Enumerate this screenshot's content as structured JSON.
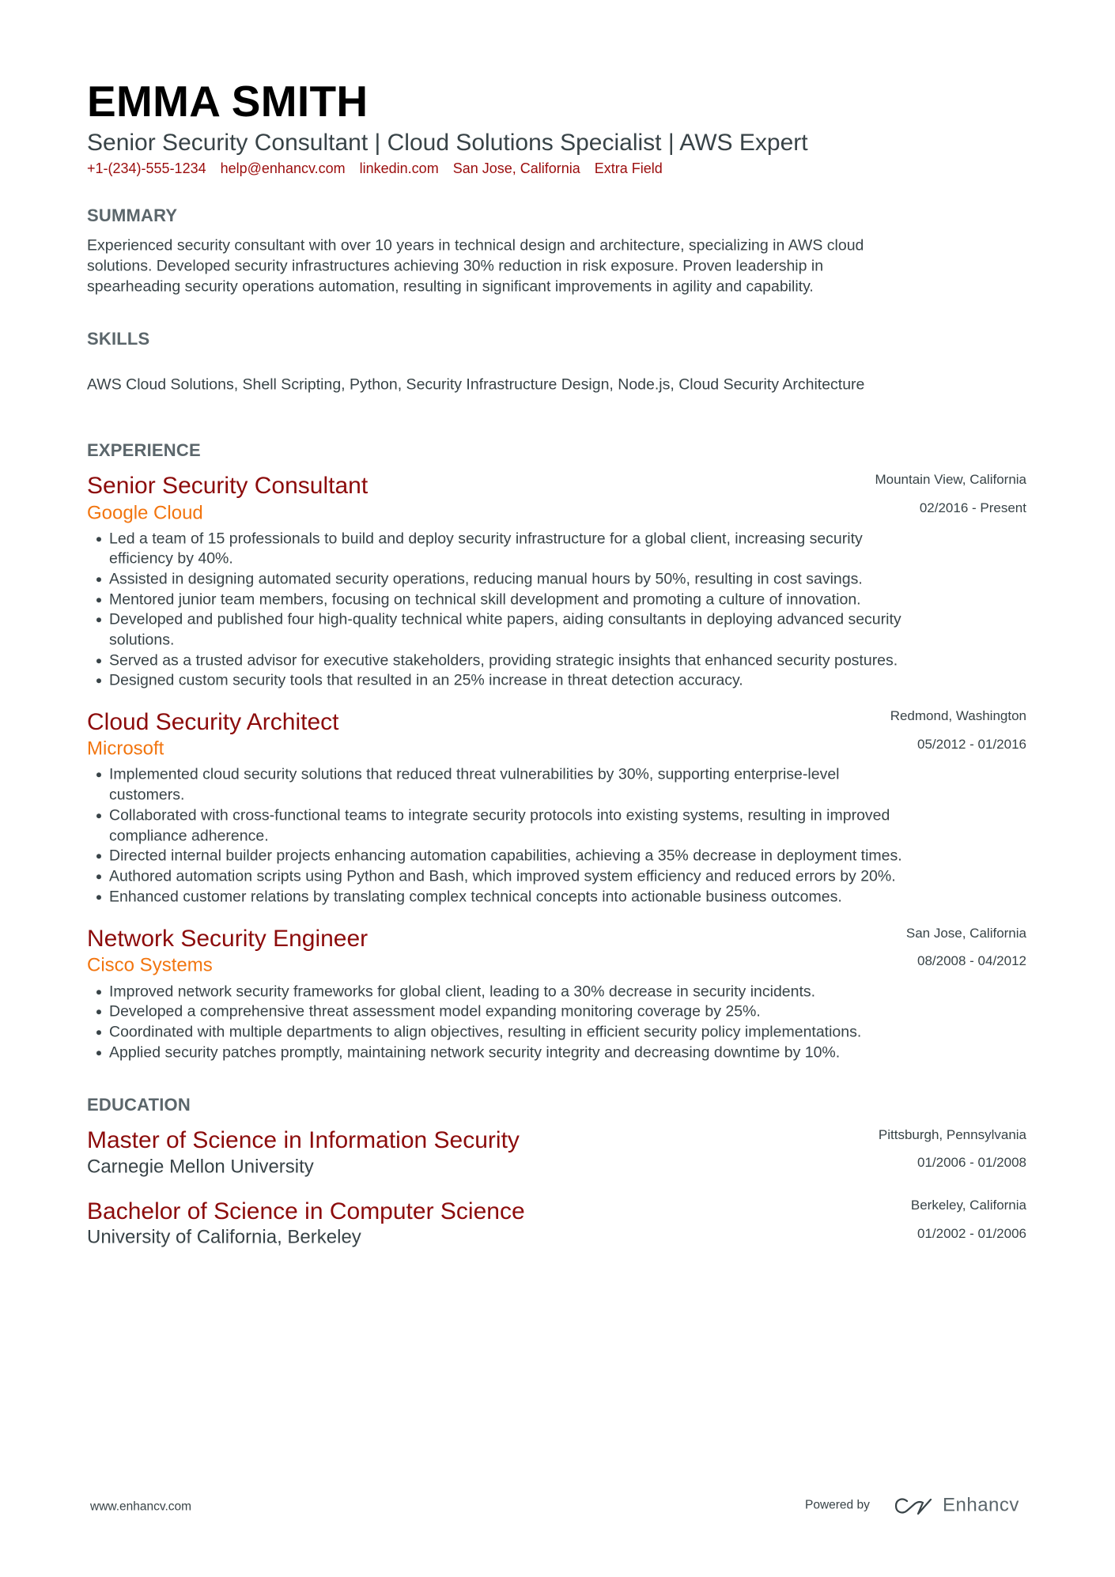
{
  "header": {
    "name": "EMMA SMITH",
    "headline": "Senior Security Consultant | Cloud Solutions Specialist | AWS Expert",
    "contacts": [
      "+1-(234)-555-1234",
      "help@enhancv.com",
      "linkedin.com",
      "San Jose, California",
      "Extra Field"
    ]
  },
  "summary": {
    "title": "SUMMARY",
    "lines": [
      "Experienced security consultant with over 10 years in technical design and architecture, specializing in AWS cloud",
      "solutions. Developed security infrastructures achieving 30% reduction in risk exposure. Proven leadership in",
      "spearheading security operations automation, resulting in significant improvements in agility and capability."
    ]
  },
  "skills": {
    "title": "SKILLS",
    "text": "AWS Cloud Solutions, Shell Scripting, Python, Security Infrastructure Design, Node.js, Cloud Security Architecture"
  },
  "experience": {
    "title": "EXPERIENCE",
    "jobs": [
      {
        "title": "Senior Security Consultant",
        "company": "Google Cloud",
        "location": "Mountain View, California",
        "dates": "02/2016 - Present",
        "bullets": [
          [
            "Led a team of 15 professionals to build and deploy security infrastructure for a global client, increasing security",
            "efficiency by 40%."
          ],
          [
            "Assisted in designing automated security operations, reducing manual hours by 50%, resulting in cost savings."
          ],
          [
            "Mentored junior team members, focusing on technical skill development and promoting a culture of innovation."
          ],
          [
            "Developed and published four high-quality technical white papers, aiding consultants in deploying advanced security",
            "solutions."
          ],
          [
            "Served as a trusted advisor for executive stakeholders, providing strategic insights that enhanced security postures."
          ],
          [
            "Designed custom security tools that resulted in an 25% increase in threat detection accuracy."
          ]
        ]
      },
      {
        "title": "Cloud Security Architect",
        "company": "Microsoft",
        "location": "Redmond, Washington",
        "dates": "05/2012 - 01/2016",
        "bullets": [
          [
            "Implemented cloud security solutions that reduced threat vulnerabilities by 30%, supporting enterprise-level",
            "customers."
          ],
          [
            "Collaborated with cross-functional teams to integrate security protocols into existing systems, resulting in improved",
            "compliance adherence."
          ],
          [
            "Directed internal builder projects enhancing automation capabilities, achieving a 35% decrease in deployment times."
          ],
          [
            "Authored automation scripts using Python and Bash, which improved system efficiency and reduced errors by 20%."
          ],
          [
            "Enhanced customer relations by translating complex technical concepts into actionable business outcomes."
          ]
        ]
      },
      {
        "title": "Network Security Engineer",
        "company": "Cisco Systems",
        "location": "San Jose, California",
        "dates": "08/2008 - 04/2012",
        "bullets": [
          [
            "Improved network security frameworks for global client, leading to a 30% decrease in security incidents."
          ],
          [
            "Developed a comprehensive threat assessment model expanding monitoring coverage by 25%."
          ],
          [
            "Coordinated with multiple departments to align objectives, resulting in efficient security policy implementations."
          ],
          [
            "Applied security patches promptly, maintaining network security integrity and decreasing downtime by 10%."
          ]
        ]
      }
    ]
  },
  "education": {
    "title": "EDUCATION",
    "items": [
      {
        "degree": "Master of Science in Information Security",
        "school": "Carnegie Mellon University",
        "location": "Pittsburgh, Pennsylvania",
        "dates": "01/2006 - 01/2008"
      },
      {
        "degree": "Bachelor of Science in Computer Science",
        "school": "University of California, Berkeley",
        "location": "Berkeley, California",
        "dates": "01/2002 - 01/2006"
      }
    ]
  },
  "footer": {
    "url": "www.enhancv.com",
    "powered_by": "Powered by",
    "brand": "Enhancv",
    "logo_icon": "enhancv-logo-icon"
  }
}
